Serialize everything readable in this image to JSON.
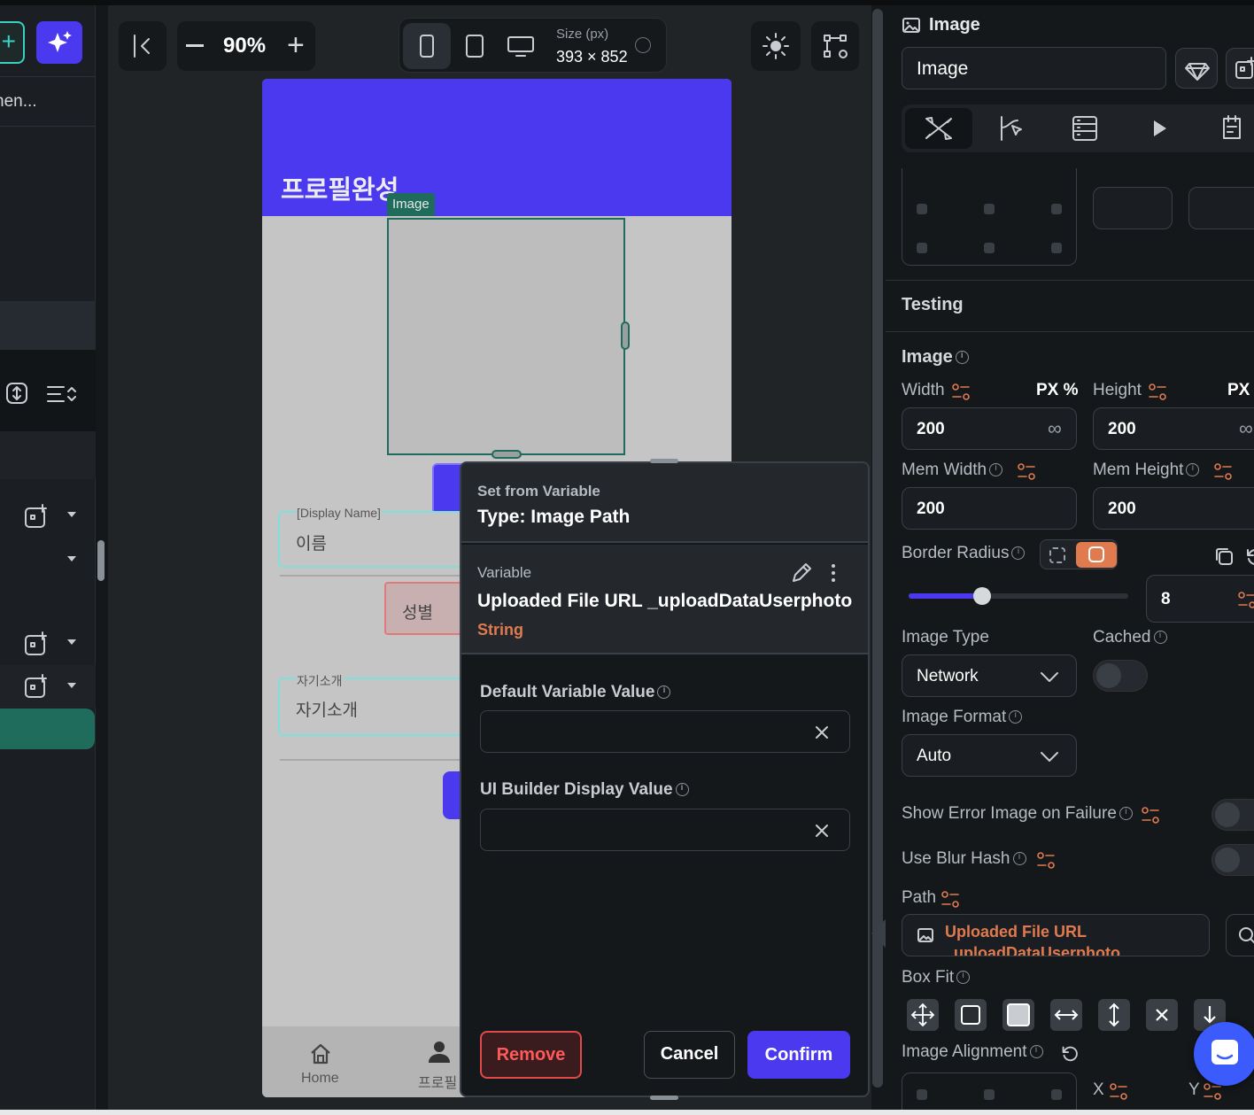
{
  "toolbar": {
    "zoom": "90%",
    "size_label": "Size (px)",
    "size_value": "393 × 852"
  },
  "left_panel": {
    "truncated_label": "nen..."
  },
  "canvas": {
    "header_title": "프로필완성",
    "image_badge": "Image",
    "display_name_label": "[Display Name]",
    "name_placeholder": "이름",
    "gender_label": "성별",
    "bio_label": "자기소개",
    "bio_placeholder": "자기소개",
    "nav_home": "Home",
    "nav_profile": "프로필"
  },
  "dialog": {
    "header_sub": "Set from Variable",
    "header_type": "Type: Image Path",
    "variable_label": "Variable",
    "variable_name": "Uploaded File URL _uploadDataUserphoto",
    "variable_type": "String",
    "default_label": "Default Variable Value",
    "default_value": "",
    "display_label": "UI Builder Display Value",
    "display_value": "",
    "remove": "Remove",
    "cancel": "Cancel",
    "confirm": "Confirm"
  },
  "props": {
    "header_title": "Image",
    "name_value": "Image",
    "testing": "Testing",
    "image_section": "Image",
    "width_label": "Width",
    "width_units": "PX %",
    "width_value": "200",
    "height_label": "Height",
    "height_unit": "PX",
    "height_value": "200",
    "mem_width_label": "Mem Width",
    "mem_width_value": "200",
    "mem_height_label": "Mem Height",
    "mem_height_value": "200",
    "border_radius_label": "Border Radius",
    "border_radius_value": "8",
    "border_radius_fraction": 0.18,
    "image_type_label": "Image Type",
    "image_type_value": "Network",
    "cached_label": "Cached",
    "image_format_label": "Image Format",
    "image_format_value": "Auto",
    "show_error_label": "Show Error Image on Failure",
    "blur_hash_label": "Use Blur Hash",
    "path_label": "Path",
    "path_value": "Uploaded File URL",
    "path_value_2": "_uploadDataUserphoto",
    "box_fit_label": "Box Fit",
    "image_alignment_label": "Image Alignment",
    "x_label": "X",
    "y_label": "Y"
  },
  "colors": {
    "accent": "#4b39ef",
    "orange": "#e07a4f",
    "teal": "#1f6b5c",
    "remove_red": "#e04a4a"
  }
}
